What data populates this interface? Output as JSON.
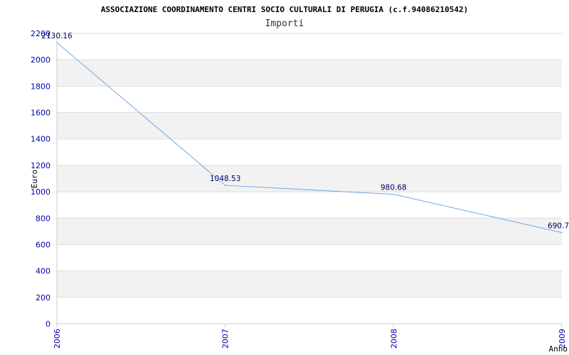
{
  "chart_data": {
    "type": "line",
    "title": "ASSOCIAZIONE COORDINAMENTO CENTRI SOCIO CULTURALI DI PERUGIA (c.f.94086210542)",
    "subtitle": "Importi",
    "xlabel": "Anno",
    "ylabel": "Euro",
    "categories": [
      "2006",
      "2007",
      "2008",
      "2009"
    ],
    "values": [
      2130.16,
      1048.53,
      980.68,
      690.7
    ],
    "data_labels": [
      "2130.16",
      "1048.53",
      "980.68",
      "690.7"
    ],
    "yticks": [
      0,
      200,
      400,
      600,
      800,
      1000,
      1200,
      1400,
      1600,
      1800,
      2000,
      2200
    ],
    "ylim": [
      0,
      2200
    ],
    "grid": true,
    "line_color": "#6fa8e8",
    "band_color": "#f2f2f2",
    "tick_color": "#0000aa"
  }
}
